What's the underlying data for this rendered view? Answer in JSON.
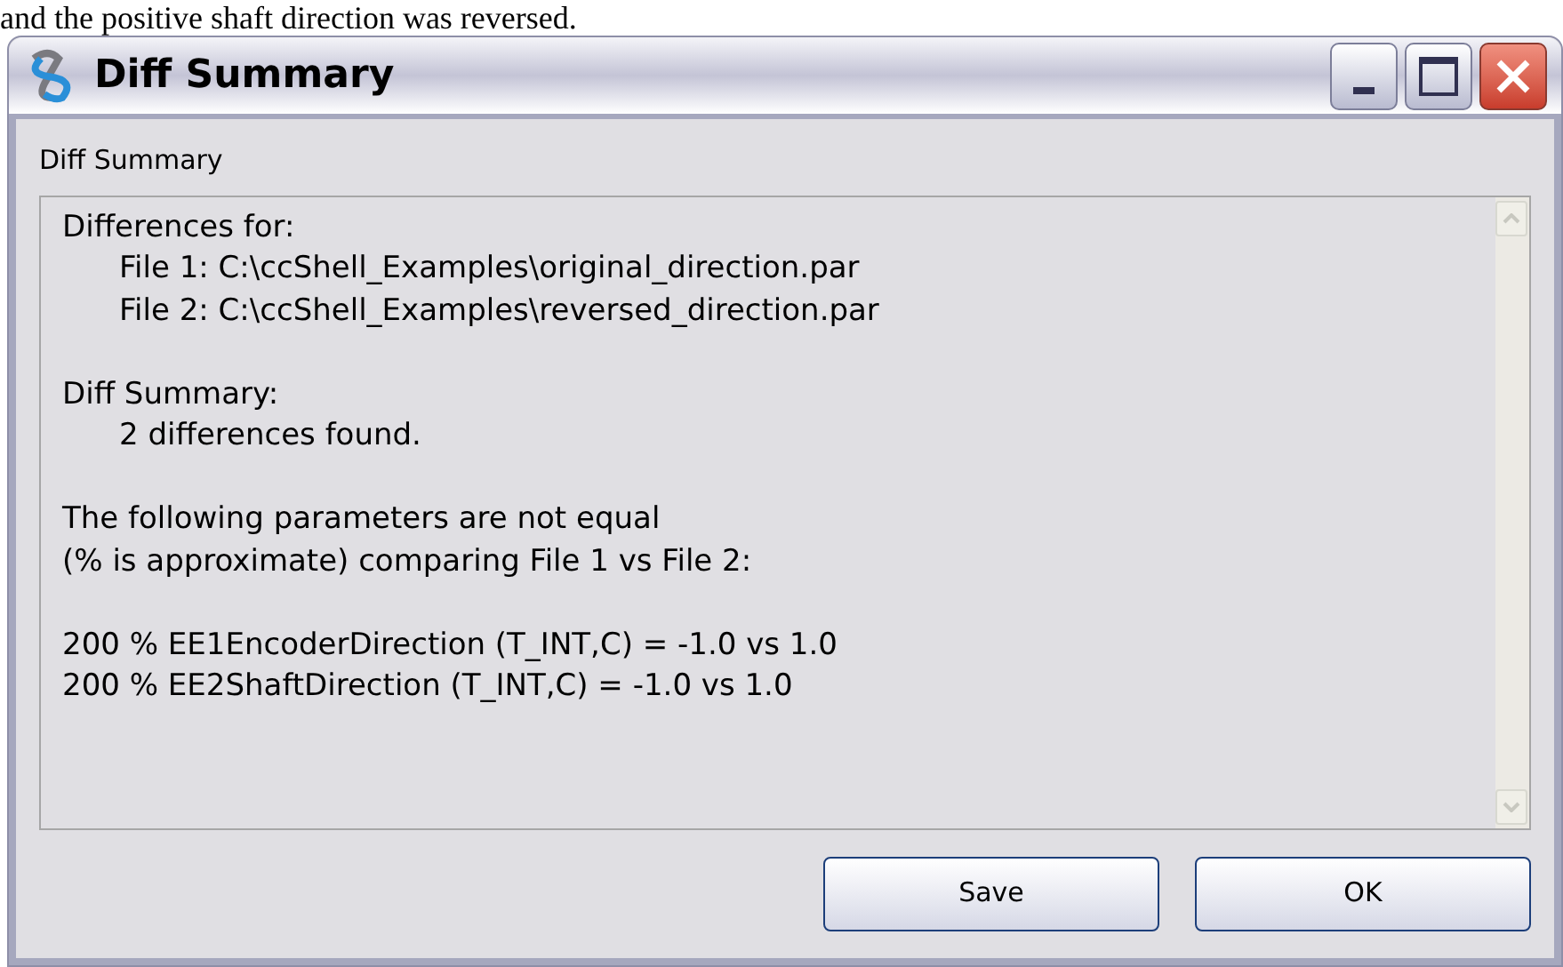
{
  "document_text": "and the positive shaft direction was reversed.",
  "window": {
    "title": "Diff Summary"
  },
  "label": "Diff Summary",
  "paragraphs": [
    {
      "lines": [
        {
          "text": "Differences for:",
          "kind": "plain"
        },
        {
          "text": "File 1: C:\\ccShell_Examples\\original_direction.par",
          "kind": "indented"
        },
        {
          "text": "File 2: C:\\ccShell_Examples\\reversed_direction.par",
          "kind": "indented"
        }
      ]
    },
    {
      "lines": [
        {
          "text": "Diff Summary:",
          "kind": "plain"
        },
        {
          "text": "2 differences found.",
          "kind": "indented"
        }
      ]
    },
    {
      "lines": [
        {
          "text": "The following parameters are not equal",
          "kind": "plain"
        },
        {
          "text": "(% is approximate) comparing File 1 vs File 2:",
          "kind": "plain"
        }
      ]
    },
    {
      "lines": [
        {
          "text": "200 % EE1EncoderDirection (T_INT,C) = -1.0 vs 1.0",
          "kind": "plain"
        },
        {
          "text": "200 % EE2ShaftDirection (T_INT,C) = -1.0 vs 1.0",
          "kind": "plain"
        }
      ]
    }
  ],
  "buttons": [
    "Save",
    "OK"
  ]
}
